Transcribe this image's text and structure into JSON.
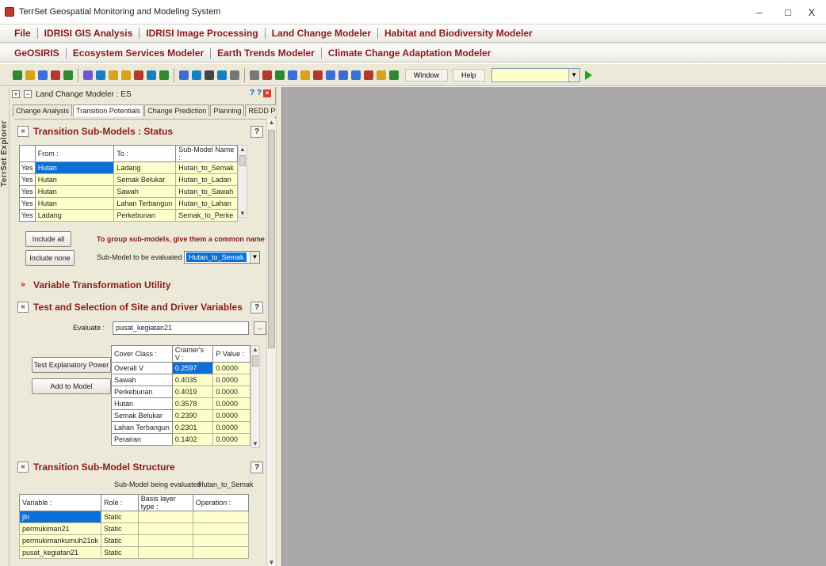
{
  "window": {
    "title": "TerrSet Geospatial Monitoring and Modeling System",
    "minimize": "–",
    "maximize": "□",
    "close": "X"
  },
  "menu1": [
    "File",
    "IDRISI GIS Analysis",
    "IDRISI Image Processing",
    "Land Change Modeler",
    "Habitat and Biodiversity Modeler"
  ],
  "menu2": [
    "GeOSIRIS",
    "Ecosystem Services Modeler",
    "Earth Trends Modeler",
    "Climate Change Adaptation Modeler"
  ],
  "toolbar": {
    "window_label": "Window",
    "help_label": "Help",
    "icon_colors": [
      "#2f8a2f",
      "#d9a21b",
      "#3c6fd1",
      "#b03a2e",
      "#2f8a2f",
      "#6a5acd",
      "#1a7fbf",
      "#d9a21b",
      "#d9a21b",
      "#b03a2e",
      "#1a7fbf",
      "#2f8a2f",
      "#3c6fd1",
      "#1a7fbf",
      "#444444",
      "#1a7fbf",
      "#777777",
      "#777777",
      "#b03a2e",
      "#2f8a2f",
      "#3c6fd1",
      "#d9a21b",
      "#b03a2e",
      "#3c6fd1",
      "#3c6fd1",
      "#3c6fd1",
      "#b03a2e",
      "#d9a21b",
      "#2f8a2f"
    ]
  },
  "explorer": {
    "label": "TerrSet Explorer"
  },
  "panel": {
    "title": "Land Change Modeler : ES",
    "title_icons": "? ?",
    "tabs": [
      "Change Analysis",
      "Transition Potentials",
      "Change Prediction",
      "Planning",
      "REDD Project"
    ],
    "active_tab": 1
  },
  "sub_models": {
    "heading": "Transition Sub-Models : Status",
    "columns": [
      "From :",
      "To :",
      "Sub-Model Name :"
    ],
    "rows": [
      {
        "flag": "Yes",
        "from": "Hutan",
        "to": "Ladang",
        "name": "Hutan_to_Semak"
      },
      {
        "flag": "Yes",
        "from": "Hutan",
        "to": "Semak Belukar",
        "name": "Hutan_to_Ladan"
      },
      {
        "flag": "Yes",
        "from": "Hutan",
        "to": "Sawah",
        "name": "Hutan_to_Sawah"
      },
      {
        "flag": "Yes",
        "from": "Hutan",
        "to": "Lahan Terbangun",
        "name": "Hutan_to_Lahan"
      },
      {
        "flag": "Yes",
        "from": "Ladang",
        "to": "Perkebunan",
        "name": "Semak_to_Perke"
      }
    ],
    "include_all": "Include all",
    "include_none": "Include none",
    "note": "To group sub-models, give them a common name",
    "eval_label": "Sub-Model to be evaluated :",
    "eval_value": "Hutan_to_Semak"
  },
  "var_transform": {
    "heading": "Variable Transformation Utility"
  },
  "test_selection": {
    "heading": "Test and Selection of Site and Driver Variables",
    "evaluate_label": "Evaluate :",
    "evaluate_value": "pusat_kegiatan21",
    "browse": "...",
    "test_button": "Test Explanatory Power",
    "add_button": "Add to Model",
    "columns": [
      "Cover Class :",
      "Cramer's V :",
      "P Value :"
    ],
    "rows": [
      {
        "cls": "Overall V",
        "v": "0.2597",
        "p": "0.0000"
      },
      {
        "cls": "Sawah",
        "v": "0.4035",
        "p": "0.0000"
      },
      {
        "cls": "Perkebunan",
        "v": "0.4019",
        "p": "0.0000"
      },
      {
        "cls": "Hutan",
        "v": "0.3578",
        "p": "0.0000"
      },
      {
        "cls": "Semak Belukar",
        "v": "0.2390",
        "p": "0.0000"
      },
      {
        "cls": "Lahan Terbangun",
        "v": "0.2301",
        "p": "0.0000"
      },
      {
        "cls": "Perairan",
        "v": "0.1402",
        "p": "0.0000"
      }
    ]
  },
  "structure": {
    "heading": "Transition Sub-Model Structure",
    "being_label": "Sub-Model being evaluated :",
    "being_value": "Hutan_to_Semak",
    "columns": [
      "Variable :",
      "Role :",
      "Basis layer type :",
      "Operation :"
    ],
    "rows": [
      {
        "var": "jln",
        "role": "Static"
      },
      {
        "var": "permukiman21",
        "role": "Static"
      },
      {
        "var": "permukimankumuh21ok",
        "role": "Static"
      },
      {
        "var": "pusat_kegiatan21",
        "role": "Static"
      }
    ]
  },
  "help": "?"
}
